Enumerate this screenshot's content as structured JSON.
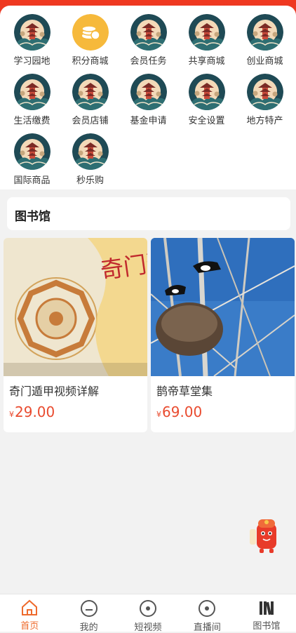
{
  "menu": {
    "items": [
      {
        "label": "学习园地",
        "icon": "pagoda-icon"
      },
      {
        "label": "积分商城",
        "icon": "coin-stack-icon"
      },
      {
        "label": "会员任务",
        "icon": "pagoda-icon"
      },
      {
        "label": "共享商城",
        "icon": "pagoda-icon"
      },
      {
        "label": "创业商城",
        "icon": "pagoda-icon"
      },
      {
        "label": "生活缴费",
        "icon": "pagoda-icon"
      },
      {
        "label": "会员店铺",
        "icon": "pagoda-icon"
      },
      {
        "label": "基金申请",
        "icon": "pagoda-icon"
      },
      {
        "label": "安全设置",
        "icon": "pagoda-icon"
      },
      {
        "label": "地方特产",
        "icon": "pagoda-icon"
      },
      {
        "label": "国际商品",
        "icon": "pagoda-icon"
      },
      {
        "label": "秒乐购",
        "icon": "pagoda-icon"
      }
    ]
  },
  "section": {
    "title": "图书馆"
  },
  "products": [
    {
      "name": "奇门遁甲视频详解",
      "currency": "¥",
      "price": "29.00",
      "cover_text": "奇门遁甲详解"
    },
    {
      "name": "鹊帝草堂集",
      "currency": "¥",
      "price": "69.00"
    }
  ],
  "tabs": [
    {
      "label": "首页",
      "icon": "home-icon",
      "active": true
    },
    {
      "label": "我的",
      "icon": "profile-icon",
      "active": false
    },
    {
      "label": "短视频",
      "icon": "video-icon",
      "active": false
    },
    {
      "label": "直播间",
      "icon": "live-icon",
      "active": false
    },
    {
      "label": "图书馆",
      "icon": "books-icon",
      "active": false
    }
  ],
  "colors": {
    "accent": "#ee6b2d",
    "price": "#e94b2f",
    "header": "#ea3a26"
  }
}
